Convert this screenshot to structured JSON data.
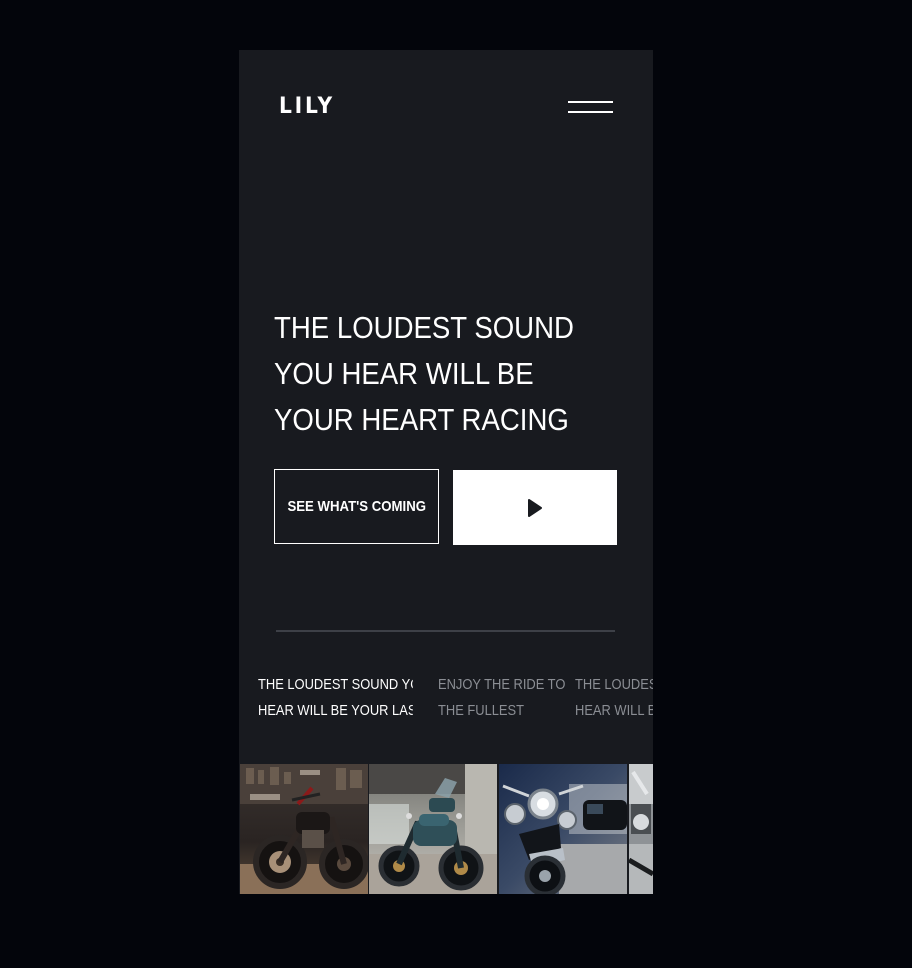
{
  "header": {
    "logo": "LILY",
    "menu_icon": "hamburger-menu-icon"
  },
  "hero": {
    "headline": "THE LOUDEST SOUND YOU HEAR WILL BE YOUR HEART RACING",
    "primary_button": "SEE WHAT'S COMING",
    "play_icon": "play-icon"
  },
  "slides": [
    {
      "line1": "THE LOUDEST SOUND YOU",
      "line2": "HEAR WILL BE YOUR LAS..."
    },
    {
      "line1": "ENJOY THE RIDE TO",
      "line2": "THE FULLEST"
    },
    {
      "line1": "THE LOUDEST",
      "line2": "HEAR WILL BE"
    }
  ],
  "thumbnails": [
    {
      "name": "motorcycle-garage-photo"
    },
    {
      "name": "motorcycle-street-photo"
    },
    {
      "name": "motorcycle-parking-photo"
    },
    {
      "name": "motorcycle-chrome-photo"
    }
  ],
  "colors": {
    "background": "#03050b",
    "panel": "#181a1f",
    "text": "#ffffff",
    "muted_text": "#8b8e94",
    "divider": "#3d4047",
    "play_icon": "#181a1f"
  }
}
